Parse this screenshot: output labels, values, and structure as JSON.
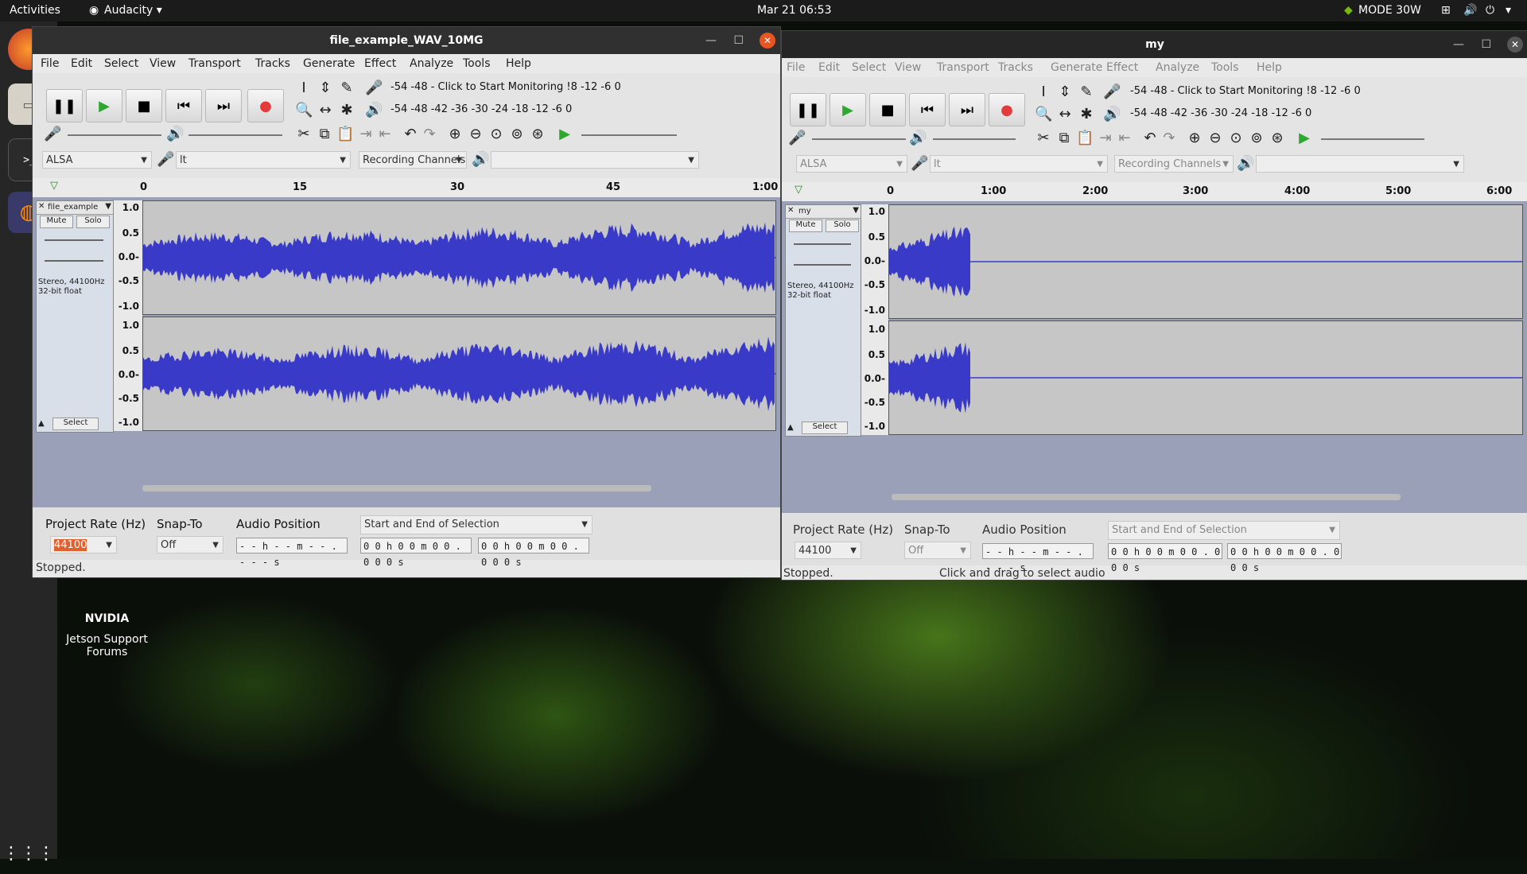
{
  "topbar": {
    "activities": "Activities",
    "app": "Audacity",
    "clock": "Mar 21  06:53",
    "mode": "MODE 30W"
  },
  "desktop": {
    "icon_label_1": "Jetson Support",
    "icon_label_2": "Forums",
    "icon_logo": "NVIDIA"
  },
  "win1": {
    "title": "file_example_WAV_10MG",
    "menus": [
      "File",
      "Edit",
      "Select",
      "View",
      "Transport",
      "Tracks",
      "Generate",
      "Effect",
      "Analyze",
      "Tools",
      "Help"
    ],
    "meter_row1": "-54   -48   -  Click to Start Monitoring !8    -12    -6     0",
    "meter_row2": "-54   -48   -42   -36   -30   -24   -18   -12    -6     0",
    "host": "ALSA",
    "mic": "lt",
    "channels": "Recording Channels",
    "ruler": [
      "0",
      "15",
      "30",
      "45",
      "1:00"
    ],
    "track_name": "file_example",
    "mute": "Mute",
    "solo": "Solo",
    "track_info_1": "Stereo, 44100Hz",
    "track_info_2": "32-bit float",
    "select": "Select",
    "scale": [
      "1.0",
      "0.5",
      "0.0-",
      "-0.5",
      "-1.0"
    ],
    "project_rate_label": "Project Rate (Hz)",
    "project_rate": "44100",
    "snap_label": "Snap-To",
    "snap_value": "Off",
    "audio_pos_label": "Audio Position",
    "audio_pos": "- - h - - m - - . - - - s",
    "sel_mode": "Start and End of Selection",
    "sel_start": "0 0 h 0 0 m 0 0 . 0 0 0 s",
    "sel_end": "0 0 h 0 0 m 0 0 . 0 0 0 s",
    "status": "Stopped."
  },
  "win2": {
    "title": "my",
    "menus": [
      "File",
      "Edit",
      "Select",
      "View",
      "Transport",
      "Tracks",
      "Generate",
      "Effect",
      "Analyze",
      "Tools",
      "Help"
    ],
    "meter_row1": "-54   -48   -  Click to Start Monitoring !8    -12    -6     0",
    "meter_row2": "-54   -48   -42   -36   -30   -24   -18   -12    -6     0",
    "host": "ALSA",
    "mic": "lt",
    "channels": "Recording Channels",
    "ruler": [
      "0",
      "1:00",
      "2:00",
      "3:00",
      "4:00",
      "5:00",
      "6:00"
    ],
    "track_name": "my",
    "mute": "Mute",
    "solo": "Solo",
    "track_info_1": "Stereo, 44100Hz",
    "track_info_2": "32-bit float",
    "select": "Select",
    "scale": [
      "1.0",
      "0.5",
      "0.0-",
      "-0.5",
      "-1.0"
    ],
    "project_rate_label": "Project Rate (Hz)",
    "project_rate": "44100",
    "snap_label": "Snap-To",
    "snap_value": "Off",
    "audio_pos_label": "Audio Position",
    "audio_pos": "- - h - - m - - . - - - s",
    "sel_mode": "Start and End of Selection",
    "sel_start": "0 0 h 0 0 m 0 0 . 0 0 0 s",
    "sel_end": "0 0 h 0 0 m 0 0 . 0 0 0 s",
    "status": "Stopped.",
    "hint": "Click and drag to select audio"
  },
  "colors": {
    "wave": "#3a3ac8",
    "record": "#e33b3b",
    "play": "#2fa82f",
    "accent": "#e06030"
  }
}
